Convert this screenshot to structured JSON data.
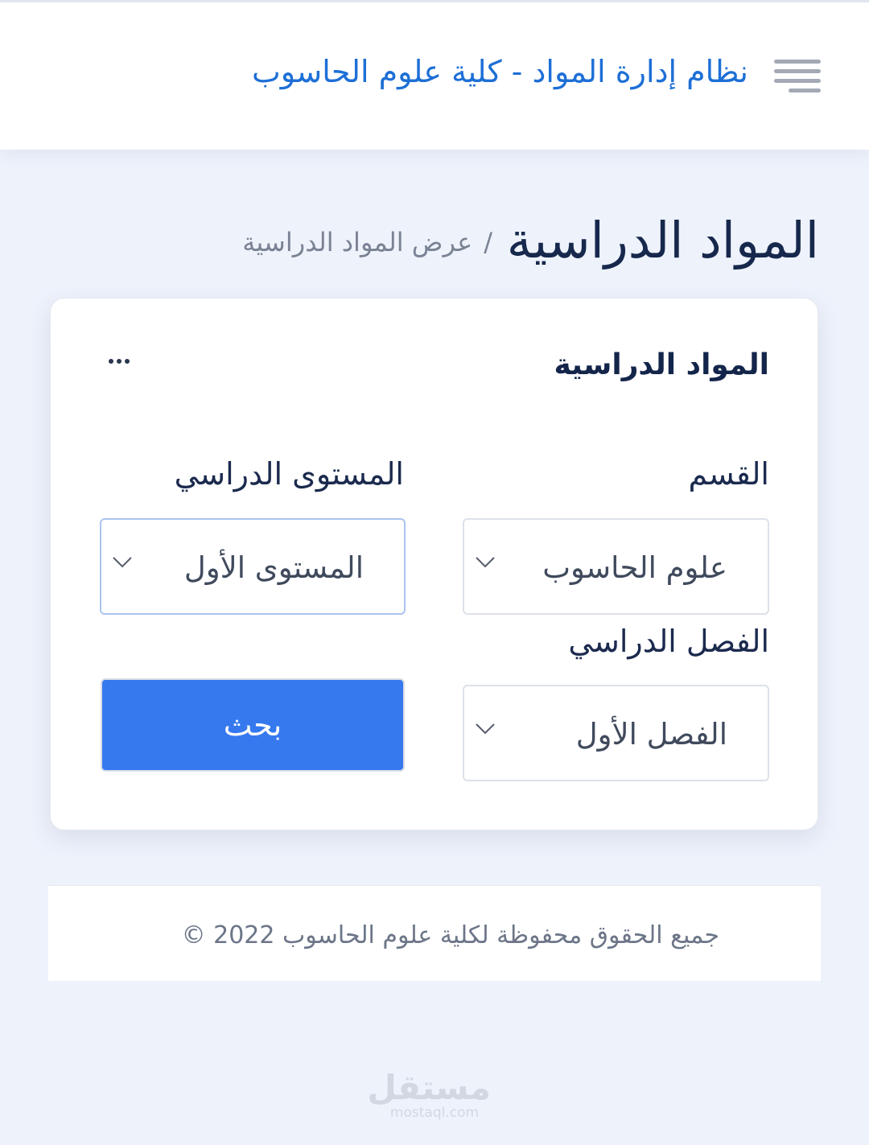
{
  "header": {
    "app_title": "نظام إدارة المواد - كلية علوم الحاسوب"
  },
  "page": {
    "title": "المواد الدراسية",
    "breadcrumb_sep": "/",
    "breadcrumb_current": "عرض المواد الدراسية"
  },
  "card": {
    "title": "المواد الدراسية",
    "more_label": "..."
  },
  "filters": {
    "department": {
      "label": "القسم",
      "value": "علوم الحاسوب"
    },
    "level": {
      "label": "المستوى الدراسي",
      "value": "المستوى الأول"
    },
    "semester": {
      "label": "الفصل الدراسي",
      "value": "الفصل الأول"
    },
    "search_label": "بحث"
  },
  "footer": {
    "copyright": "جميع الحقوق محفوظة لكلية علوم الحاسوب 2022 ©"
  },
  "watermark": {
    "arabic": "مستقل",
    "latin": "mostaql.com"
  },
  "colors": {
    "accent": "#3679ef",
    "title_blue": "#1d6fd6",
    "background": "#eef2fb"
  },
  "icons": {
    "menu": "hamburger-icon",
    "more": "ellipsis-icon",
    "dropdown": "chevron-down-icon"
  }
}
